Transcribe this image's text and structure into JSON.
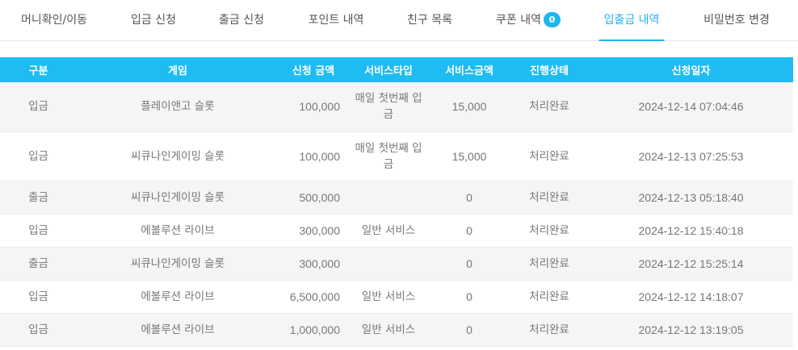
{
  "tabs": [
    {
      "label": "머니확인/이동",
      "active": false
    },
    {
      "label": "입금 신청",
      "active": false
    },
    {
      "label": "출금 신청",
      "active": false
    },
    {
      "label": "포인트 내역",
      "active": false
    },
    {
      "label": "친구 목록",
      "active": false
    },
    {
      "label": "쿠폰 내역",
      "badge": "0",
      "active": false
    },
    {
      "label": "입출금 내역",
      "active": true
    },
    {
      "label": "비밀번호 변경",
      "active": false
    }
  ],
  "table": {
    "headers": [
      "구분",
      "게임",
      "신청 금액",
      "서비스타입",
      "서비스금액",
      "진행상태",
      "신청일자"
    ],
    "rows": [
      {
        "type": "입금",
        "game": "플레이앤고 슬롯",
        "amount": "100,000",
        "service_type": "매일 첫번째 입금",
        "service_amount": "15,000",
        "status": "처리완료",
        "date": "2024-12-14 07:04:46"
      },
      {
        "type": "입금",
        "game": "씨큐나인게이밍 슬롯",
        "amount": "100,000",
        "service_type": "매일 첫번째 입금",
        "service_amount": "15,000",
        "status": "처리완료",
        "date": "2024-12-13 07:25:53"
      },
      {
        "type": "출금",
        "game": "씨큐나인게이밍 슬롯",
        "amount": "500,000",
        "service_type": "",
        "service_amount": "0",
        "status": "처리완료",
        "date": "2024-12-13 05:18:40"
      },
      {
        "type": "입금",
        "game": "에볼루션 라이브",
        "amount": "300,000",
        "service_type": "일반 서비스",
        "service_amount": "0",
        "status": "처리완료",
        "date": "2024-12-12 15:40:18"
      },
      {
        "type": "출금",
        "game": "씨큐나인게이밍 슬롯",
        "amount": "300,000",
        "service_type": "",
        "service_amount": "0",
        "status": "처리완료",
        "date": "2024-12-12 15:25:14"
      },
      {
        "type": "입금",
        "game": "에볼루션 라이브",
        "amount": "6,500,000",
        "service_type": "일반 서비스",
        "service_amount": "0",
        "status": "처리완료",
        "date": "2024-12-12 14:18:07"
      },
      {
        "type": "입금",
        "game": "에볼루션 라이브",
        "amount": "1,000,000",
        "service_type": "일반 서비스",
        "service_amount": "0",
        "status": "처리완료",
        "date": "2024-12-12 13:19:05"
      }
    ]
  },
  "colors": {
    "accent": "#1fbbf3",
    "row_alt": "#f5f5f5",
    "text": "#777777"
  }
}
